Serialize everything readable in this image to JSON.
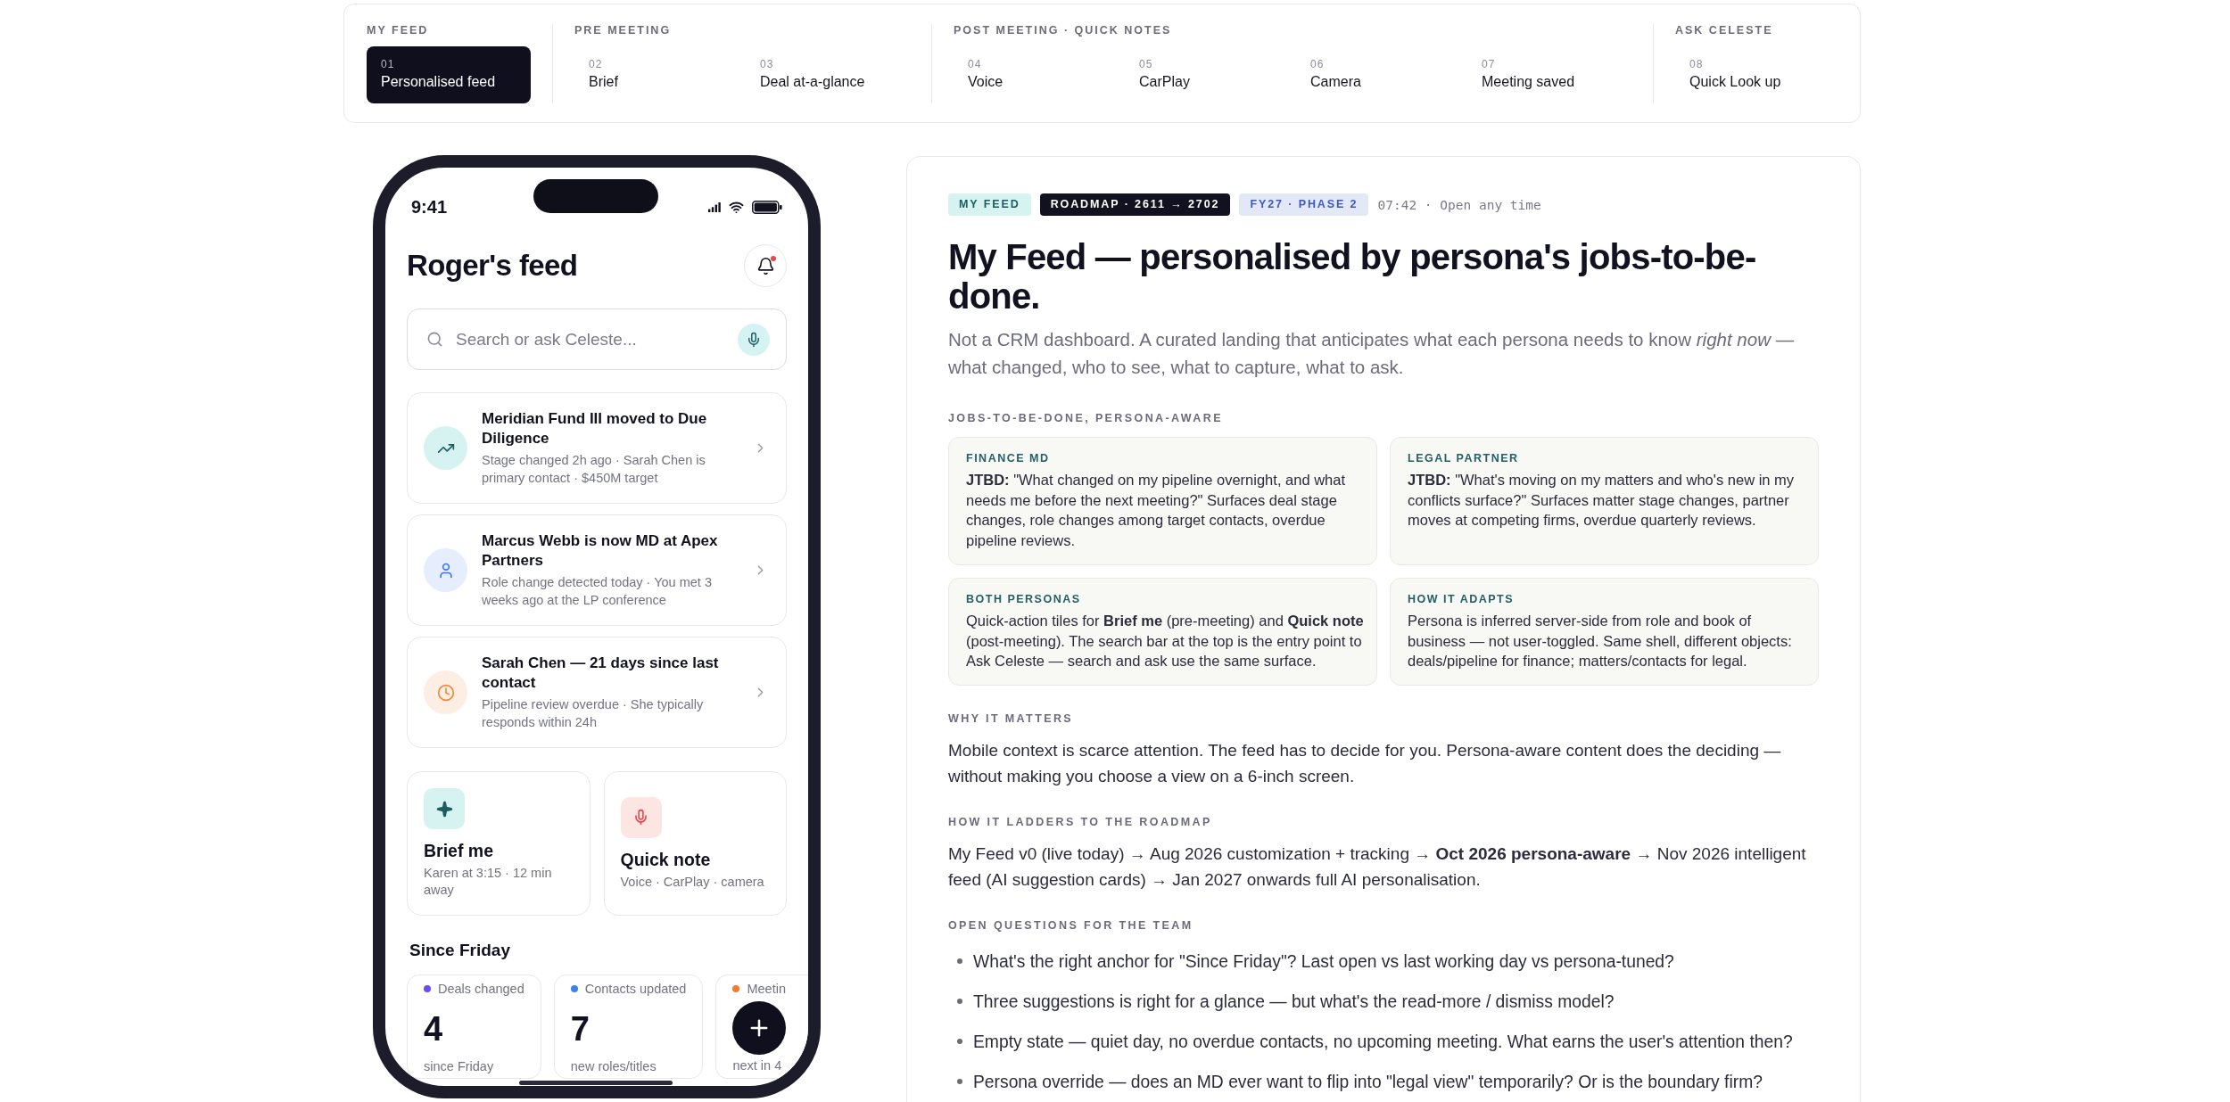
{
  "nav": {
    "groups": [
      {
        "label": "MY FEED",
        "items": [
          {
            "number": "01",
            "label": "Personalised feed",
            "selected": true
          }
        ]
      },
      {
        "label": "PRE MEETING",
        "items": [
          {
            "number": "02",
            "label": "Brief",
            "selected": false
          },
          {
            "number": "03",
            "label": "Deal at-a-glance",
            "selected": false
          }
        ]
      },
      {
        "label": "POST MEETING · QUICK NOTES",
        "items": [
          {
            "number": "04",
            "label": "Voice",
            "selected": false
          },
          {
            "number": "05",
            "label": "CarPlay",
            "selected": false
          },
          {
            "number": "06",
            "label": "Camera",
            "selected": false
          },
          {
            "number": "07",
            "label": "Meeting saved",
            "selected": false
          }
        ]
      },
      {
        "label": "ASK CELESTE",
        "items": [
          {
            "number": "08",
            "label": "Quick Look up",
            "selected": false
          }
        ]
      }
    ]
  },
  "phone": {
    "status_bar": {
      "time": "9:41"
    },
    "title": "Roger's feed",
    "notifications": {
      "unread": true
    },
    "search": {
      "placeholder": "Search or ask Celeste..."
    },
    "feed_cards": [
      {
        "kind": "stage",
        "title": "Meridian Fund III moved to Due Diligence",
        "detail": "Stage changed 2h ago · Sarah Chen is primary contact · $450M target"
      },
      {
        "kind": "role",
        "title": "Marcus Webb is now MD at Apex Partners",
        "detail": "Role change detected today · You met 3 weeks ago at the LP conference"
      },
      {
        "kind": "overdue",
        "title": "Sarah Chen — 21 days since last contact",
        "detail": "Pipeline review overdue · She typically responds within 24h"
      }
    ],
    "quick_actions": [
      {
        "kind": "brief",
        "title": "Brief me",
        "detail": "Karen at 3:15 · 12 min away"
      },
      {
        "kind": "note",
        "title": "Quick note",
        "detail": "Voice · CarPlay · camera"
      }
    ],
    "since_heading": "Since Friday",
    "stats": [
      {
        "label": "Deals changed",
        "color": "#6d4aff",
        "value": "4",
        "caption": "since Friday"
      },
      {
        "label": "Contacts updated",
        "color": "#3b82f6",
        "value": "7",
        "caption": "new roles/titles"
      },
      {
        "label": "Meetin",
        "color": "#f97a2a",
        "caption": "next in 4"
      }
    ]
  },
  "panel": {
    "tags": [
      {
        "kind": "section",
        "text": "MY FEED"
      },
      {
        "kind": "roadmap",
        "text": "ROADMAP · 2611 → 2702"
      },
      {
        "kind": "phase",
        "text": "FY27 · PHASE 2"
      }
    ],
    "meta": "07:42 · Open any time",
    "title": "My Feed — personalised by persona's jobs-to-be-done.",
    "intro": "Not a CRM dashboard. A curated landing that anticipates what each persona needs to know *right now* — what changed, who to see, what to capture, what to ask.",
    "sections": [
      {
        "kind": "cards",
        "heading": "JOBS-TO-BE-DONE, PERSONA-AWARE",
        "cards": [
          {
            "title": "FINANCE MD",
            "body": "**JTBD:** \"What changed on my pipeline overnight, and what needs me before the next meeting?\" Surfaces deal stage changes, role changes among target contacts, overdue pipeline reviews."
          },
          {
            "title": "LEGAL PARTNER",
            "body": "**JTBD:** \"What's moving on my matters and who's new in my conflicts surface?\" Surfaces matter stage changes, partner moves at competing firms, overdue quarterly reviews."
          },
          {
            "title": "BOTH PERSONAS",
            "body": "Quick-action tiles for **Brief me** (pre-meeting) and **Quick note** (post-meeting). The search bar at the top is the entry point to Ask Celeste — search and ask use the same surface."
          },
          {
            "title": "HOW IT ADAPTS",
            "body": "Persona is inferred server-side from role and book of business — not user-toggled. Same shell, different objects: deals/pipeline for finance; matters/contacts for legal."
          }
        ]
      },
      {
        "kind": "paragraph",
        "heading": "WHY IT MATTERS",
        "text": "Mobile context is scarce attention. The feed has to decide for you. Persona-aware content does the deciding — without making you choose a view on a 6-inch screen."
      },
      {
        "kind": "paragraph",
        "heading": "HOW IT LADDERS TO THE ROADMAP",
        "text": "My Feed v0 (live today) → Aug 2026 customization + tracking → **Oct 2026 persona-aware** → Nov 2026 intelligent feed (AI suggestion cards) → Jan 2027 onwards full AI personalisation."
      },
      {
        "kind": "list",
        "heading": "OPEN QUESTIONS FOR THE TEAM",
        "items": [
          "What's the right anchor for \"Since Friday\"? Last open vs last working day vs persona-tuned?",
          "Three suggestions is right for a glance — but what's the read-more / dismiss model?",
          "Empty state — quiet day, no overdue contacts, no upcoming meeting. What earns the user's attention then?",
          "Persona override — does an MD ever want to flip into \"legal view\" temporarily? Or is the boundary firm?"
        ]
      }
    ]
  }
}
